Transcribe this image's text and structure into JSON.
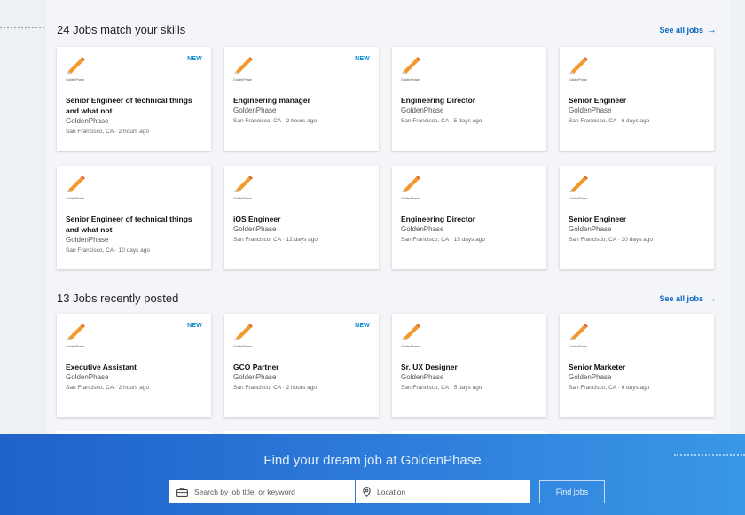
{
  "sections": [
    {
      "title": "24 Jobs match your skills",
      "see_all": "See all jobs",
      "cards": [
        {
          "title": "Senior Engineer of technical things and what not",
          "company": "GoldenPhase",
          "meta": "San Francisco, CA · 2 hours ago",
          "badge": "NEW"
        },
        {
          "title": "Engineering manager",
          "company": "GoldenPhase",
          "meta": "San Francisco, CA · 2 hours ago",
          "badge": "NEW"
        },
        {
          "title": "Engineering Director",
          "company": "GoldenPhase",
          "meta": "San Francisco, CA · 5 days ago",
          "badge": ""
        },
        {
          "title": "Senior Engineer",
          "company": "GoldenPhase",
          "meta": "San Francisco, CA · 6 days ago",
          "badge": ""
        },
        {
          "title": "Senior Engineer of technical things and what not",
          "company": "GoldenPhase",
          "meta": "San Francisco, CA · 10 days ago",
          "badge": ""
        },
        {
          "title": "iOS Engineer",
          "company": "GoldenPhase",
          "meta": "San Francisco, CA · 12 days ago",
          "badge": ""
        },
        {
          "title": "Engineering Director",
          "company": "GoldenPhase",
          "meta": "San Francisco, CA · 15 days ago",
          "badge": ""
        },
        {
          "title": "Senior Engineer",
          "company": "GoldenPhase",
          "meta": "San Francisco, CA · 20 days ago",
          "badge": ""
        }
      ]
    },
    {
      "title": "13 Jobs recently posted",
      "see_all": "See all jobs",
      "cards": [
        {
          "title": "Executive Assistant",
          "company": "GoldenPhase",
          "meta": "San Francisco, CA · 2 hours ago",
          "badge": "NEW"
        },
        {
          "title": "GCO Partner",
          "company": "GoldenPhase",
          "meta": "San Francisco, CA · 2 hours ago",
          "badge": "NEW"
        },
        {
          "title": "Sr. UX Designer",
          "company": "GoldenPhase",
          "meta": "San Francisco, CA · 5 days ago",
          "badge": ""
        },
        {
          "title": "Senior Marketer",
          "company": "GoldenPhase",
          "meta": "San Francisco, CA · 6 days ago",
          "badge": ""
        }
      ]
    }
  ],
  "logo_text": "GoldenPhase",
  "footer": {
    "title": "Find your dream job at GoldenPhase",
    "search_placeholder": "Search by job title, or keyword",
    "location_placeholder": "Location",
    "button": "Find jobs"
  },
  "colors": {
    "accent": "#0a66c2",
    "badge": "#0a87d0",
    "logo_orange": "#f29a2e",
    "footer_start": "#1f62c9",
    "footer_end": "#3a97e6"
  },
  "icons": {
    "see_all": "arrow-right-icon",
    "search": "briefcase-icon",
    "location": "location-pin-icon"
  }
}
